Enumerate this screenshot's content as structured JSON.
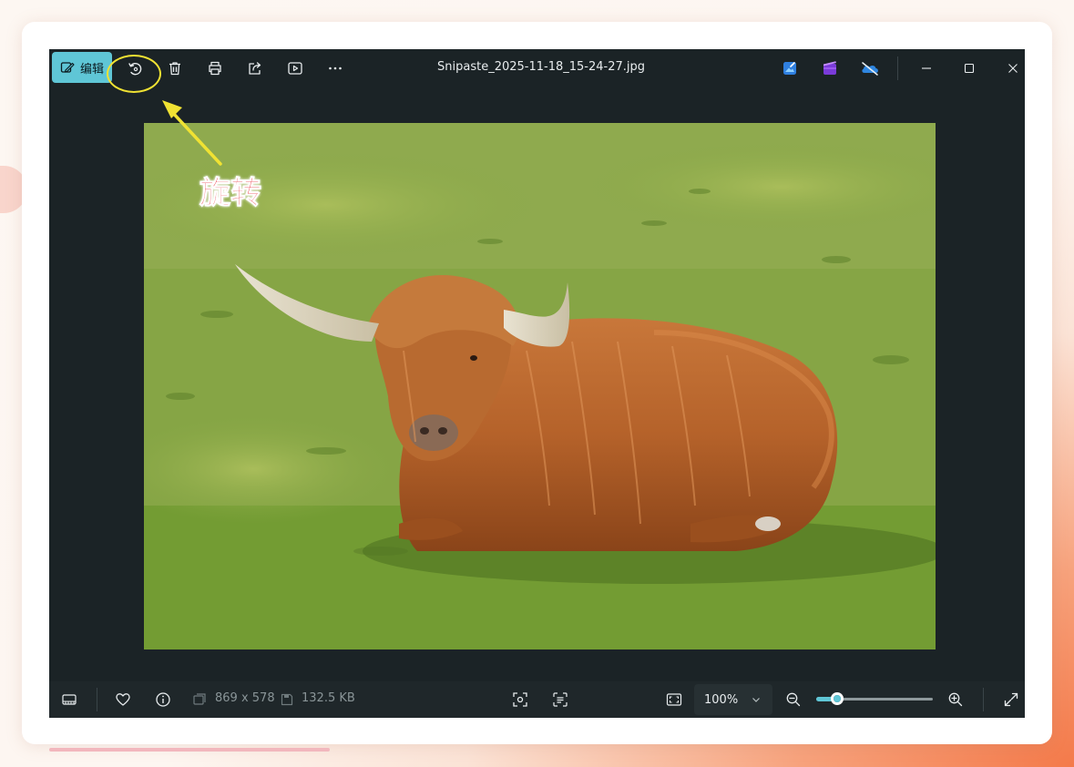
{
  "window": {
    "title": "Snipaste_2025-11-18_15-24-27.jpg",
    "edit_label": "编辑"
  },
  "annotation": {
    "label": "旋转",
    "color": "#e8313c",
    "highlight_color": "#f0e233"
  },
  "status": {
    "dimensions": "869 x 578",
    "filesize": "132.5 KB"
  },
  "zoom": {
    "value": "100%",
    "slider_level": 0.18
  },
  "colors": {
    "accent": "#5fc6d6",
    "background": "#1b2326"
  },
  "icons": {
    "rotate": "rotate-icon",
    "delete": "trash-icon",
    "print": "printer-icon",
    "share": "share-icon",
    "slideshow": "play-icon",
    "more": "more-icon",
    "designer": "image-edit-icon",
    "clipchamp": "clipchamp-icon",
    "onedrive": "onedrive-icon"
  }
}
